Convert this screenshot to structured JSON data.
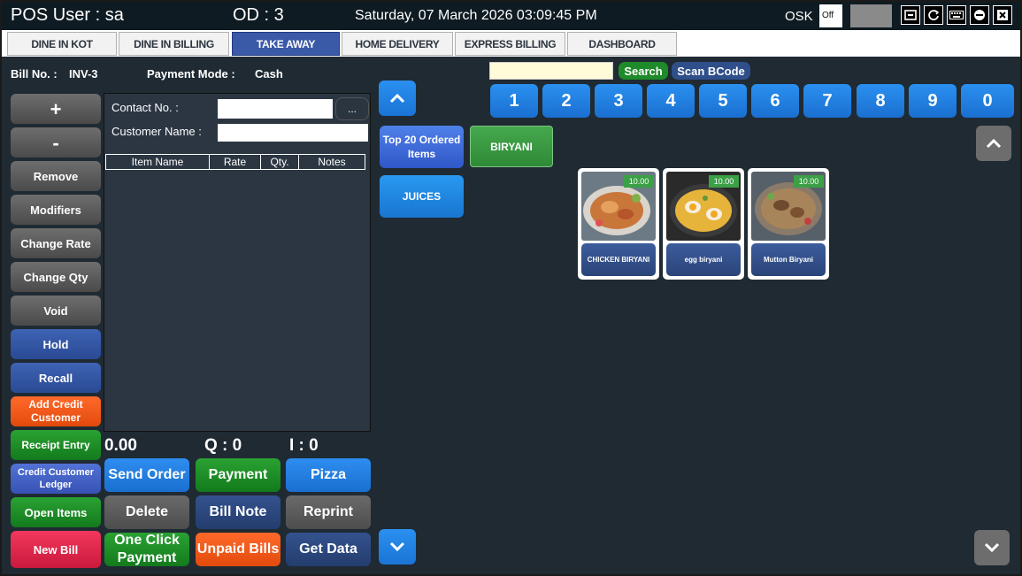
{
  "titlebar": {
    "user": "POS User : sa",
    "od": "OD : 3",
    "datetime": "Saturday, 07 March 2026 03:09:45 PM",
    "osk_label": "OSK",
    "osk_state": "Off"
  },
  "tabs": [
    {
      "label": "DINE IN KOT"
    },
    {
      "label": "DINE IN BILLING"
    },
    {
      "label": "TAKE AWAY"
    },
    {
      "label": "HOME DELIVERY"
    },
    {
      "label": "EXPRESS BILLING"
    },
    {
      "label": "DASHBOARD"
    }
  ],
  "active_tab": "TAKE AWAY",
  "bill": {
    "bill_no_label": "Bill No. :",
    "bill_no": "INV-3",
    "payment_mode_label": "Payment Mode :",
    "payment_mode": "Cash"
  },
  "side_buttons": {
    "plus": "+",
    "minus": "-",
    "remove": "Remove",
    "modifiers": "Modifiers",
    "change_rate": "Change Rate",
    "change_qty": "Change Qty",
    "void": "Void",
    "hold": "Hold",
    "recall": "Recall",
    "add_credit_customer": "Add Credit Customer",
    "receipt_entry": "Receipt Entry",
    "credit_customer_ledger": "Credit Customer Ledger",
    "open_items": "Open Items",
    "new_bill": "New Bill"
  },
  "customer": {
    "contact_label": "Contact No. :",
    "contact_value": "",
    "name_label": "Customer Name :",
    "name_value": "",
    "lookup_label": "..."
  },
  "item_table": {
    "columns": [
      "Item Name",
      "Rate",
      "Qty.",
      "Notes"
    ]
  },
  "totals": {
    "amount": "0.00",
    "qty": "Q : 0",
    "items": "I : 0"
  },
  "action_buttons": {
    "send_order": "Send Order",
    "payment": "Payment",
    "pizza": "Pizza",
    "delete": "Delete",
    "bill_note": "Bill Note",
    "reprint": "Reprint",
    "one_click_payment": "One Click Payment",
    "unpaid_bills": "Unpaid Bills",
    "get_data": "Get Data"
  },
  "categories": [
    {
      "label": "Top 20 Ordered Items"
    },
    {
      "label": "JUICES"
    }
  ],
  "search": {
    "value": "",
    "search_label": "Search",
    "scan_label": "Scan BCode"
  },
  "numpad": [
    "1",
    "2",
    "3",
    "4",
    "5",
    "6",
    "7",
    "8",
    "9",
    "0"
  ],
  "group": {
    "label": "BIRYANI"
  },
  "items": [
    {
      "name": "CHICKEN BIRYANI",
      "price": "10.00"
    },
    {
      "name": "egg biryani",
      "price": "10.00"
    },
    {
      "name": "Mutton Biryani",
      "price": "10.00"
    }
  ],
  "colors": {
    "background": "#1f2a33",
    "active_tab": "#3a5aa8",
    "accent_blue": "#1a74d6",
    "green": "#2aa233",
    "orange": "#ff6a2a",
    "red": "#f3375c"
  }
}
